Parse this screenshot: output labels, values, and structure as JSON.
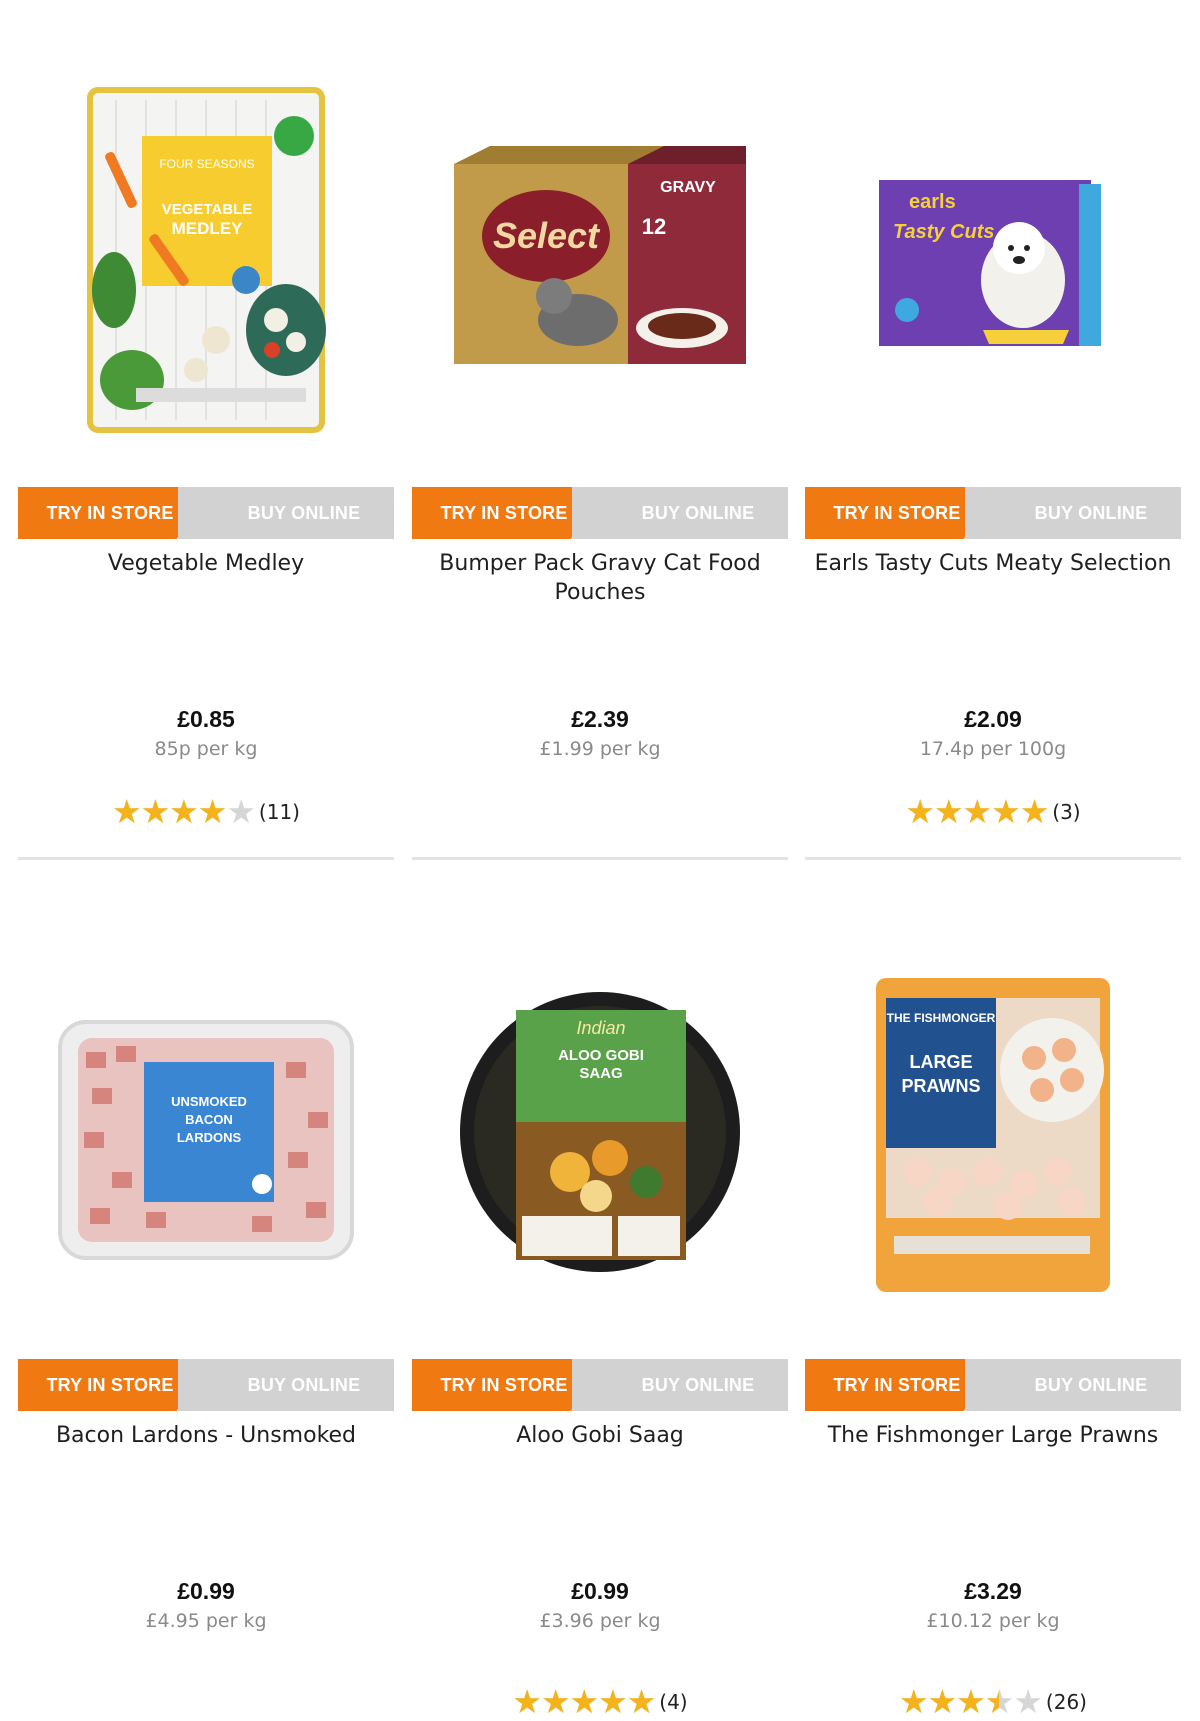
{
  "labels": {
    "try_in_store": "TRY IN STORE",
    "buy_online": "BUY ONLINE"
  },
  "colors": {
    "accent": "#f07a11",
    "tab_inactive": "#d2d2d2",
    "star": "#f5b31b",
    "star_empty": "#d6d6d6"
  },
  "products": [
    {
      "name": "Vegetable Medley",
      "price": "£0.85",
      "unit_price": "85p per kg",
      "rating": 4,
      "rating_count": "(11)",
      "image_icon": "frozen-vegetables-bag-icon",
      "pack_text": {
        "brand": "FOUR SEASONS",
        "title": "VEGETABLE MEDLEY"
      }
    },
    {
      "name": "Bumper Pack Gravy Cat Food Pouches",
      "price": "£2.39",
      "unit_price": "£1.99 per kg",
      "rating": null,
      "rating_count": "",
      "image_icon": "cat-food-box-icon",
      "pack_text": {
        "brand": "Select",
        "title": "GRAVY",
        "count": "12"
      }
    },
    {
      "name": "Earls Tasty Cuts Meaty Selection",
      "price": "£2.09",
      "unit_price": "17.4p per 100g",
      "rating": 5,
      "rating_count": "(3)",
      "image_icon": "dog-food-box-icon",
      "pack_text": {
        "brand": "earls",
        "title": "Tasty Cuts"
      }
    },
    {
      "name": "Bacon Lardons - Unsmoked",
      "price": "£0.99",
      "unit_price": "£4.95 per kg",
      "rating": null,
      "rating_count": "",
      "image_icon": "bacon-tray-icon",
      "pack_text": {
        "title": "UNSMOKED BACON LARDONS"
      }
    },
    {
      "name": "Aloo Gobi Saag",
      "price": "£0.99",
      "unit_price": "£3.96 per kg",
      "rating": 5,
      "rating_count": "(4)",
      "image_icon": "curry-tray-icon",
      "pack_text": {
        "brand": "Indian",
        "title": "ALOO GOBI SAAG"
      }
    },
    {
      "name": "The Fishmonger Large Prawns",
      "price": "£3.29",
      "unit_price": "£10.12 per kg",
      "rating": 3.5,
      "rating_count": "(26)",
      "image_icon": "prawns-bag-icon",
      "pack_text": {
        "brand": "THE FISHMONGER",
        "title": "LARGE PRAWNS"
      }
    }
  ]
}
